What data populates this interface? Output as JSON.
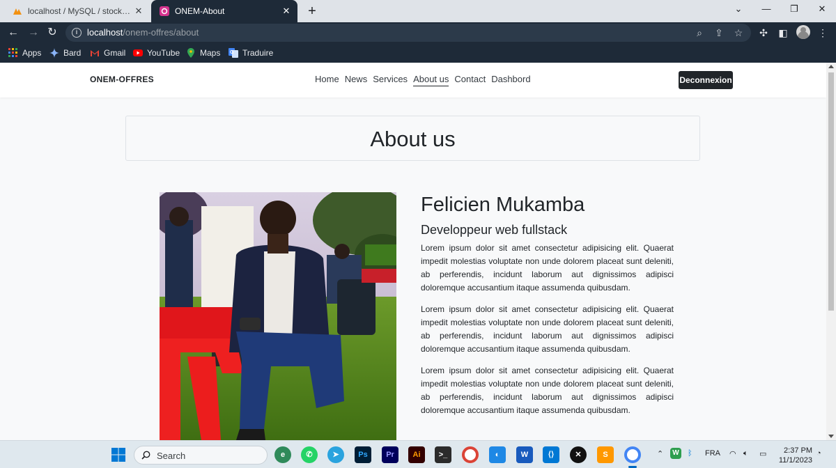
{
  "browser": {
    "tabs": [
      {
        "title": "localhost / MySQL / stock_pharm",
        "active": false
      },
      {
        "title": "ONEM-About",
        "active": true
      }
    ],
    "url_host": "localhost",
    "url_path": "/onem-offres/about",
    "bookmarks": [
      "Apps",
      "Bard",
      "Gmail",
      "YouTube",
      "Maps",
      "Traduire"
    ]
  },
  "site": {
    "brand": "ONEM-OFFRES",
    "nav": [
      "Home",
      "News",
      "Services",
      "About us",
      "Contact",
      "Dashbord"
    ],
    "active_nav": "About us",
    "logout_label": "Deconnexion",
    "page_title": "About us",
    "profile": {
      "name": "Felicien Mukamba",
      "role": "Developpeur web fullstack",
      "paragraphs": [
        "Lorem ipsum dolor sit amet consectetur adipisicing elit. Quaerat impedit molestias voluptate non unde dolorem placeat sunt deleniti, ab perferendis, incidunt laborum aut dignissimos adipisci doloremque accusantium itaque assumenda quibusdam.",
        "Lorem ipsum dolor sit amet consectetur adipisicing elit. Quaerat impedit molestias voluptate non unde dolorem placeat sunt deleniti, ab perferendis, incidunt laborum aut dignissimos adipisci doloremque accusantium itaque assumenda quibusdam.",
        "Lorem ipsum dolor sit amet consectetur adipisicing elit. Quaerat impedit molestias voluptate non unde dolorem placeat sunt deleniti, ab perferendis, incidunt laborum aut dignissimos adipisci doloremque accusantium itaque assumenda quibusdam."
      ]
    }
  },
  "taskbar": {
    "search_placeholder": "Search",
    "language": "FRA",
    "time": "2:37 PM",
    "date": "11/1/2023"
  },
  "colors": {
    "chrome_dark": "#1e2a38",
    "nav_button": "#212529",
    "page_bg": "#f8f9fa"
  }
}
